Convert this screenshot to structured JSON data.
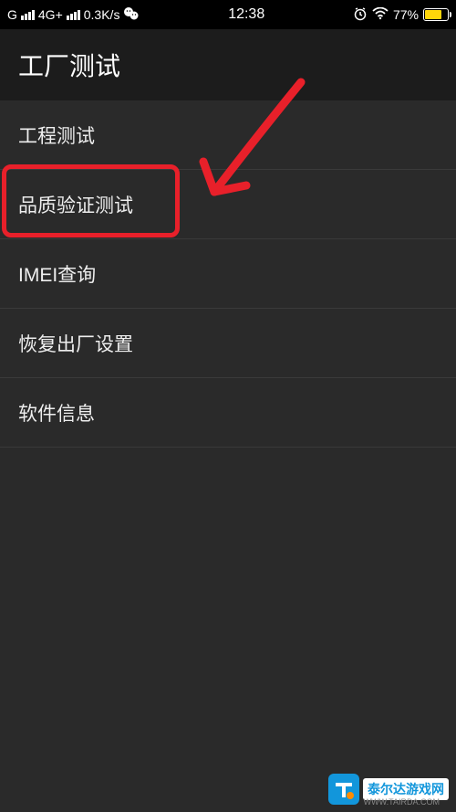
{
  "status_bar": {
    "carrier": "G",
    "network": "4G+",
    "speed": "0.3K/s",
    "time": "12:38",
    "battery_pct": "77%",
    "battery_fill": 77
  },
  "header": {
    "title": "工厂测试"
  },
  "menu": {
    "items": [
      {
        "label": "工程测试"
      },
      {
        "label": "品质验证测试"
      },
      {
        "label": "IMEI查询"
      },
      {
        "label": "恢复出厂设置"
      },
      {
        "label": "软件信息"
      }
    ]
  },
  "annotation": {
    "highlighted_index": 1,
    "color": "#e8202a"
  },
  "watermark": {
    "badge": "T",
    "text": "泰尔达游戏网",
    "url": "WWW.TAIRDA.COM"
  }
}
